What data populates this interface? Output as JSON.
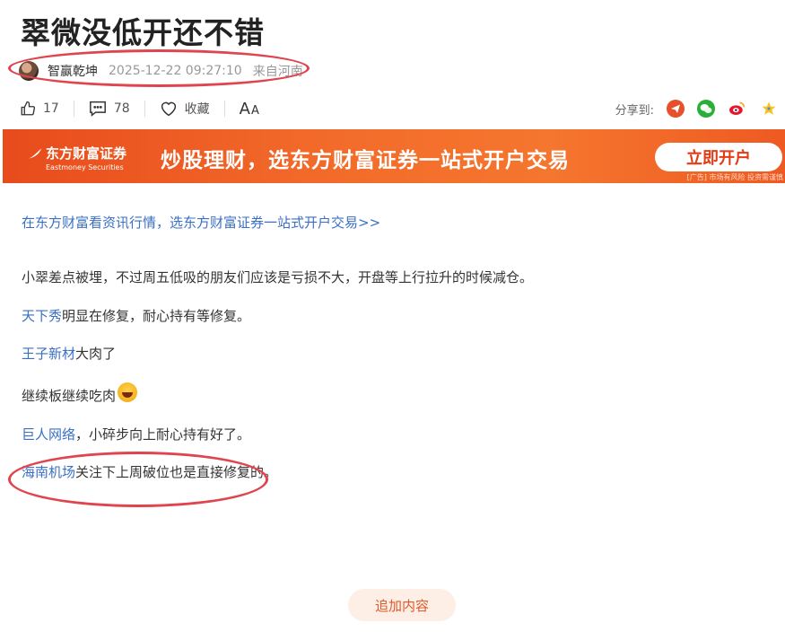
{
  "article": {
    "title": "翠微没低开还不错",
    "author": "智赢乾坤",
    "time": "2025-12-22 09:27:10",
    "location": "来自河南"
  },
  "toolbar": {
    "like_count": "17",
    "comment_count": "78",
    "favorite_label": "收藏",
    "font_big": "A",
    "font_small": "A",
    "share_label": "分享到:"
  },
  "icons": {
    "like": "thumbs-up-icon",
    "comment": "comment-icon",
    "favorite": "heart-icon",
    "share_icons": [
      "send-share-icon",
      "wechat-icon",
      "weibo-icon",
      "star-icon"
    ]
  },
  "banner": {
    "logo_cn": "东方财富证券",
    "logo_en": "Eastmoney Securities",
    "slogan": "炒股理财，选东方财富证券一站式开户交易",
    "button": "立即开户",
    "ad_note": "[广告] 市场有风险 投资需谨慎"
  },
  "content": {
    "promo_link": "在东方财富看资讯行情，选东方财富证券一站式开户交易>>",
    "p1": "小翠差点被埋，不过周五低吸的朋友们应该是亏损不大，开盘等上行拉升的时候减仓。",
    "p2_link": "天下秀",
    "p2_text": "明显在修复，耐心持有等修复。",
    "p3_link": "王子新材",
    "p3_text": "大肉了",
    "p4_text": "继续板继续吃肉",
    "p5_link": "巨人网络",
    "p5_text": "，小碎步向上耐心持有好了。",
    "p6_link": "海南机场",
    "p6_text": "关注下上周破位也是直接修复的。"
  },
  "footer": {
    "add_content": "追加内容"
  },
  "colors": {
    "annotation_red": "#e0454f",
    "link_blue": "#3a6fc4",
    "banner_orange": "#f26a2a"
  }
}
